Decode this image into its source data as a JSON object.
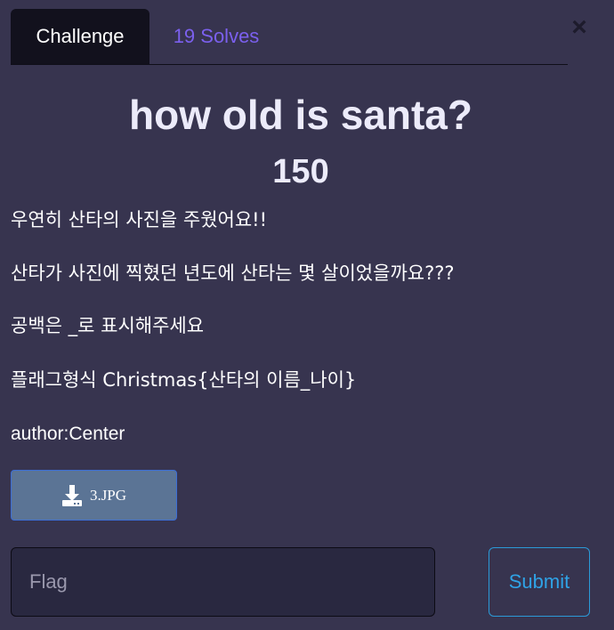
{
  "tabs": {
    "challenge": "Challenge",
    "solves": "19 Solves"
  },
  "close_label": "×",
  "challenge": {
    "name": "how old is santa?",
    "value": "150",
    "description": [
      "우연히 산타의 사진을 주웠어요!!",
      "산타가 사진에 찍혔던 년도에 산타는 몇 살이었을까요???",
      "공백은 _로 표시해주세요",
      "플래그형식 Christmas{산타의 이름_나이}",
      "author:Center"
    ],
    "file": {
      "icon": "download-icon",
      "name": "3.JPG"
    }
  },
  "submission": {
    "placeholder": "Flag",
    "value": "",
    "submit_label": "Submit"
  },
  "colors": {
    "background": "#37344f",
    "active_tab": "#12111d",
    "solves_tab_text": "#7b60ee",
    "file_button": "#5b7495",
    "submit_accent": "#2fa3e6"
  }
}
